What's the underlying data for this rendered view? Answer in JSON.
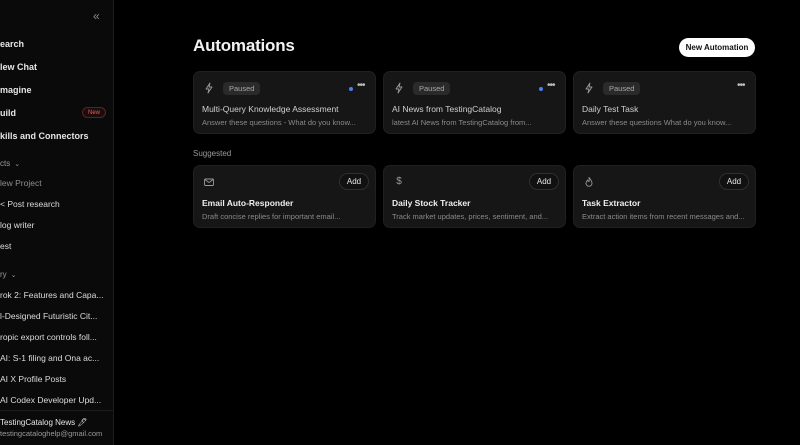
{
  "sidebar": {
    "nav": [
      {
        "label": "earch"
      },
      {
        "label": "lew Chat"
      },
      {
        "label": "magine"
      },
      {
        "label": "uild"
      },
      {
        "label": "kills and Connectors"
      }
    ],
    "build_badge": "New",
    "projects_head": "cts",
    "projects": [
      {
        "label": "lew Project"
      },
      {
        "label": "< Post research"
      },
      {
        "label": "log writer"
      },
      {
        "label": "est"
      }
    ],
    "history_head": "ry",
    "history": [
      {
        "label": "rok 2: Features and Capa..."
      },
      {
        "label": "l-Designed Futuristic Cit..."
      },
      {
        "label": "ropic export controls foll..."
      },
      {
        "label": "AI: S-1 filing and Ona ac..."
      },
      {
        "label": "AI X Profile Posts"
      },
      {
        "label": "AI Codex Developer Upd..."
      }
    ],
    "account_name": "TestingCatalog News 🖊",
    "account_email": "testingcataloghelp@gmail.com"
  },
  "main": {
    "title": "Automations",
    "new_button": "New Automation",
    "automations": [
      {
        "status": "Paused",
        "title": "Multi-Query Knowledge Assessment",
        "desc": "Answer these questions - What do you know...",
        "has_dot": true
      },
      {
        "status": "Paused",
        "title": "AI News from TestingCatalog",
        "desc": "latest AI News from TestingCatalog from...",
        "has_dot": true
      },
      {
        "status": "Paused",
        "title": "Daily Test Task",
        "desc": "Answer these questions What do you know...",
        "has_dot": false
      }
    ],
    "suggested_label": "Suggested",
    "suggested": [
      {
        "icon": "mail-icon",
        "add": "Add",
        "title": "Email Auto-Responder",
        "desc": "Draft concise replies for important email..."
      },
      {
        "icon": "dollar-icon",
        "add": "Add",
        "title": "Daily Stock Tracker",
        "desc": "Track market updates, prices, sentiment, and..."
      },
      {
        "icon": "flame-icon",
        "add": "Add",
        "title": "Task Extractor",
        "desc": "Extract action items from recent messages and..."
      }
    ]
  },
  "colors": {
    "background": "#000000",
    "card": "#161616",
    "accent_dot": "#4d7ef2",
    "badge": "#e55b5b"
  }
}
